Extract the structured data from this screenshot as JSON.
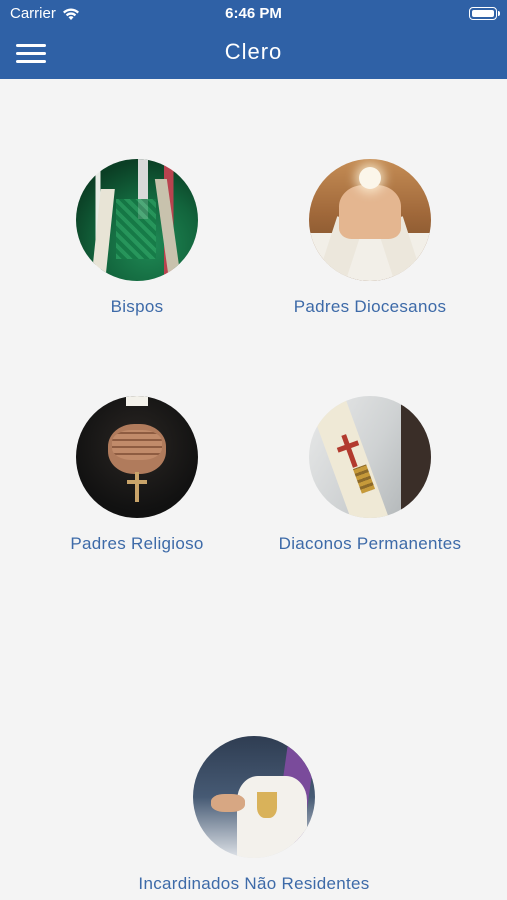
{
  "status_bar": {
    "carrier": "Carrier",
    "time": "6:46 PM"
  },
  "navbar": {
    "title": "Clero"
  },
  "tiles": [
    {
      "label": "Bispos"
    },
    {
      "label": "Padres Diocesanos"
    },
    {
      "label": "Padres Religioso"
    },
    {
      "label": "Diaconos Permanentes"
    },
    {
      "label": "Incardinados Não Residentes"
    }
  ],
  "colors": {
    "header": "#2f61a6",
    "label": "#3d6aa8",
    "background": "#f4f4f4"
  }
}
